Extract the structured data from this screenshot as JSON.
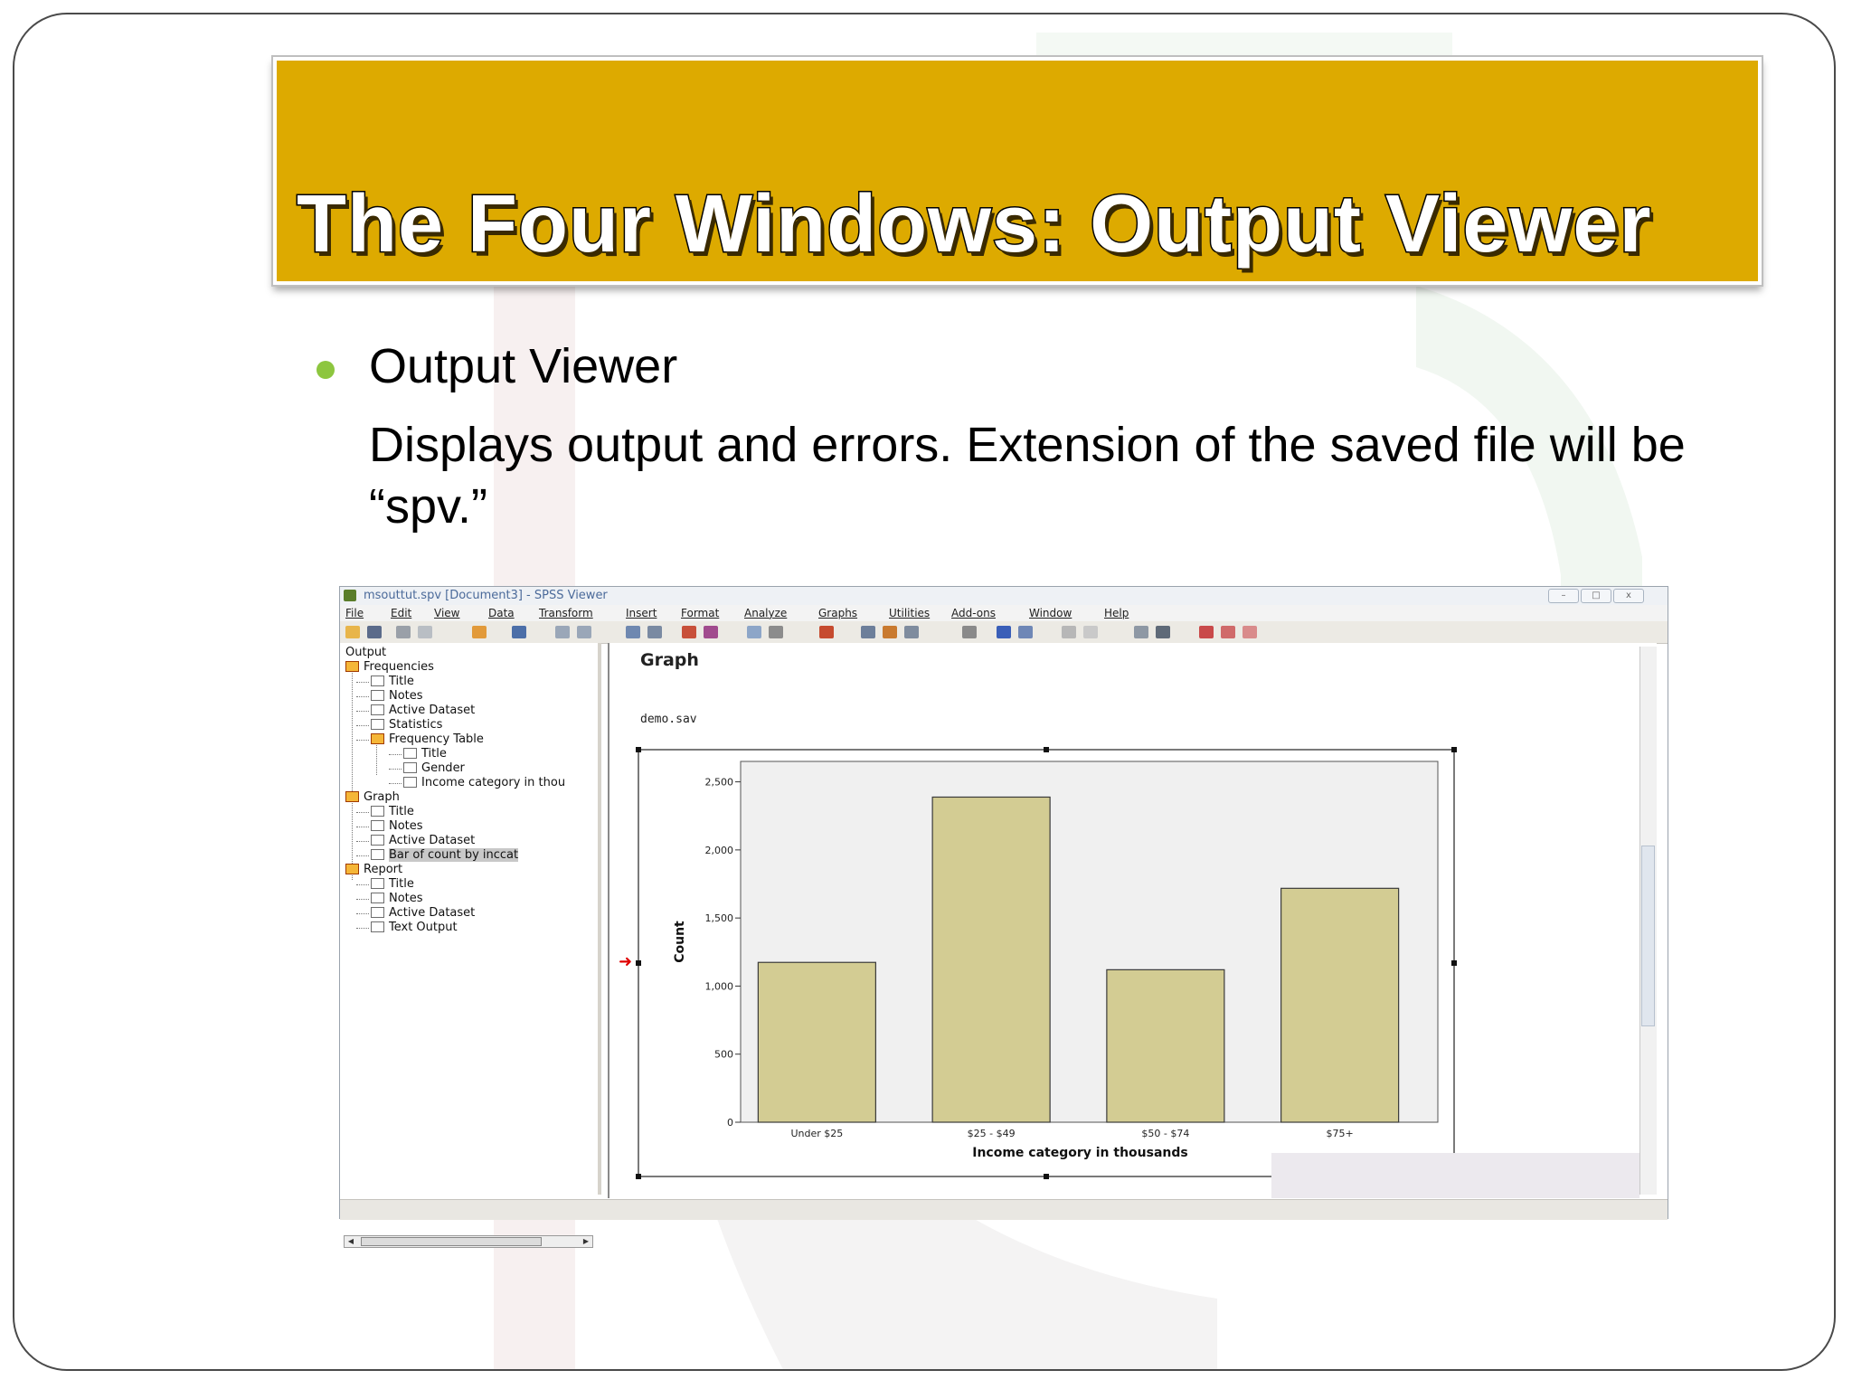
{
  "slide": {
    "title": "The Four Windows: Output Viewer",
    "bullet_heading": "Output Viewer",
    "bullet_text": "Displays output and errors. Extension of the saved file will be “spv.”"
  },
  "spss": {
    "window_title": "msouttut.spv [Document3] - SPSS Viewer",
    "window_buttons": [
      "–",
      "□",
      "x"
    ],
    "menu": [
      "File",
      "Edit",
      "View",
      "Data",
      "Transform",
      "Insert",
      "Format",
      "Analyze",
      "Graphs",
      "Utilities",
      "Add-ons",
      "Window",
      "Help"
    ],
    "tree": [
      {
        "label": "Output",
        "level": 0,
        "icon": "none"
      },
      {
        "label": "Frequencies",
        "level": 0,
        "icon": "book"
      },
      {
        "label": "Title",
        "level": 1,
        "icon": "page"
      },
      {
        "label": "Notes",
        "level": 1,
        "icon": "page"
      },
      {
        "label": "Active Dataset",
        "level": 1,
        "icon": "page"
      },
      {
        "label": "Statistics",
        "level": 1,
        "icon": "page"
      },
      {
        "label": "Frequency Table",
        "level": 1,
        "icon": "book"
      },
      {
        "label": "Title",
        "level": 2,
        "icon": "page"
      },
      {
        "label": "Gender",
        "level": 2,
        "icon": "page"
      },
      {
        "label": "Income category in thou",
        "level": 2,
        "icon": "page"
      },
      {
        "label": "Graph",
        "level": 0,
        "icon": "book"
      },
      {
        "label": "Title",
        "level": 1,
        "icon": "page"
      },
      {
        "label": "Notes",
        "level": 1,
        "icon": "page"
      },
      {
        "label": "Active Dataset",
        "level": 1,
        "icon": "page"
      },
      {
        "label": "Bar of count by inccat",
        "level": 1,
        "icon": "chart",
        "selected": true
      },
      {
        "label": "Report",
        "level": 0,
        "icon": "book"
      },
      {
        "label": "Title",
        "level": 1,
        "icon": "page"
      },
      {
        "label": "Notes",
        "level": 1,
        "icon": "page"
      },
      {
        "label": "Active Dataset",
        "level": 1,
        "icon": "page"
      },
      {
        "label": "Text Output",
        "level": 1,
        "icon": "page"
      }
    ],
    "output_heading": "Graph",
    "dataset": "demo.sav"
  },
  "chart_data": {
    "type": "bar",
    "categories": [
      "Under $25",
      "$25 - $49",
      "$50 - $74",
      "$75+"
    ],
    "values": [
      1174,
      2388,
      1120,
      1718
    ],
    "xlabel": "Income category in thousands",
    "ylabel": "Count",
    "ylim": [
      0,
      2650
    ],
    "yticks": [
      0,
      500,
      1000,
      1500,
      2000,
      2500
    ],
    "ytick_labels": [
      "0",
      "500",
      "1,000",
      "1,500",
      "2,000",
      "2,500"
    ],
    "colors": {
      "bar": "#d3cc93",
      "bar_edge": "#3a3a3a",
      "plot_bg": "#f0f0f0"
    }
  },
  "colors": {
    "title_band": "#ddaa00",
    "bullet": "#8dc63f"
  }
}
